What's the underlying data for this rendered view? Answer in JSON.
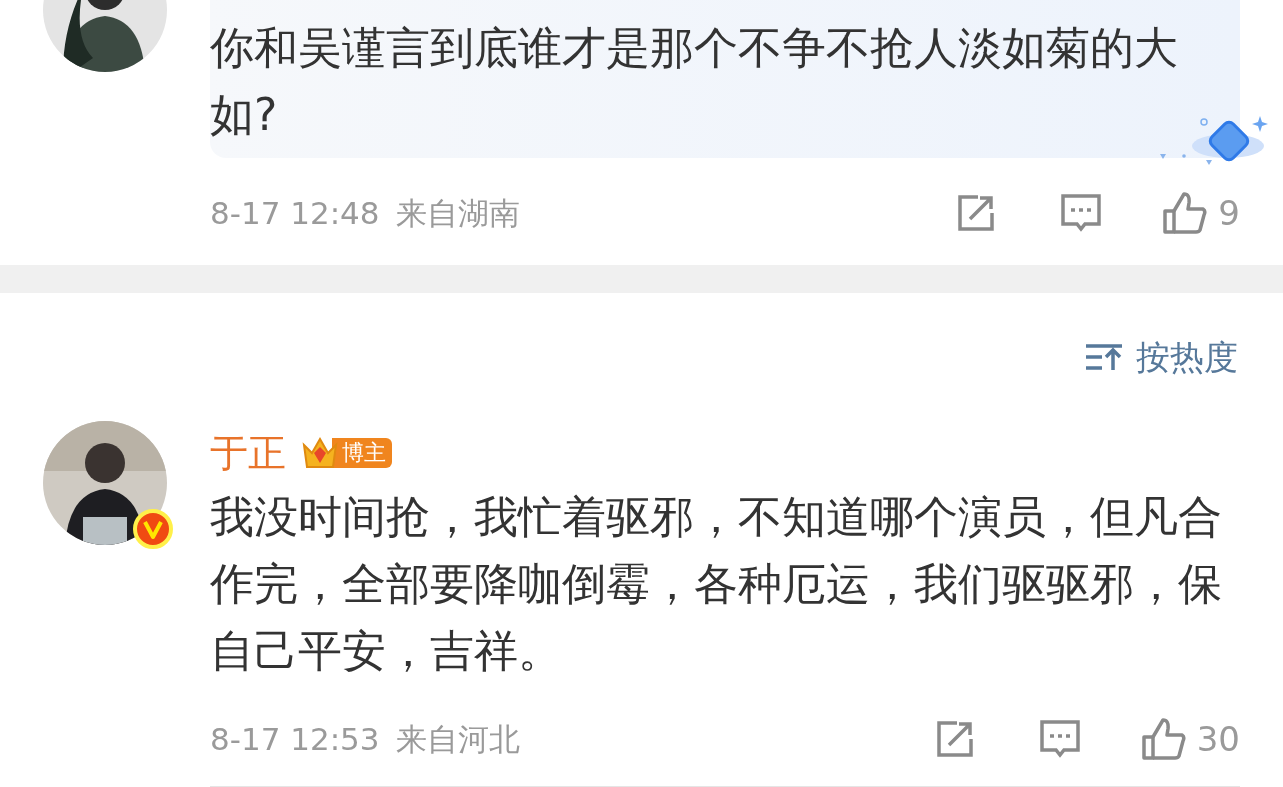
{
  "reply": {
    "verified": false,
    "highlighted": true,
    "text": "你和吴谨言到底谁才是那个不争不抢人淡如菊的大如?",
    "time": "8-17 12:48",
    "location": "来自湖南",
    "likes": "9"
  },
  "sort": {
    "label": "按热度"
  },
  "comments": [
    {
      "author": "于正",
      "badge": "博主",
      "verified": true,
      "highlighted": false,
      "text": "我没时间抢，我忙着驱邪，不知道哪个演员，但凡合作完，全部要降咖倒霉，各种厄运，我们驱驱邪，保自己平安，吉祥。",
      "time": "8-17 12:53",
      "location": "来自河北",
      "likes": "30"
    }
  ]
}
